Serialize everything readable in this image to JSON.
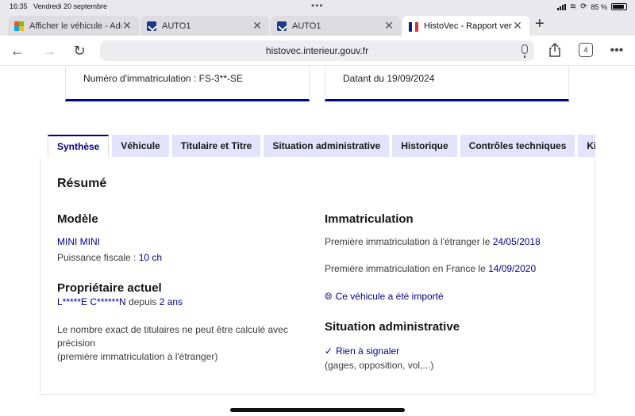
{
  "status_bar": {
    "time": "16:35",
    "date": "Vendredi 20 septembre",
    "battery": "85 %"
  },
  "browser_tabs": [
    {
      "title": "Afficher le véhicule - Adm",
      "favicon": "microsoft-icon",
      "active": false
    },
    {
      "title": "AUTO1",
      "favicon": "auto1-icon",
      "active": false
    },
    {
      "title": "AUTO1",
      "favicon": "auto1-icon",
      "active": false
    },
    {
      "title": "HistoVec - Rapport vendeur",
      "favicon": "france-flag-icon",
      "active": true
    }
  ],
  "toolbar": {
    "url": "histovec.interieur.gouv.fr",
    "tab_count": "4"
  },
  "cards": {
    "registration": "Numéro d'immatriculation : FS-3**-SE",
    "dated": "Datant du 19/09/2024"
  },
  "page_tabs": [
    "Synthèse",
    "Véhicule",
    "Titulaire et Titre",
    "Situation administrative",
    "Historique",
    "Contrôles techniques",
    "Kilométrage"
  ],
  "summary": {
    "title": "Résumé",
    "model": {
      "heading": "Modèle",
      "name": "MINI MINI",
      "power_label": "Puissance fiscale : ",
      "power_value": "10 ch"
    },
    "owner": {
      "heading": "Propriétaire actuel",
      "name": "L*****E C******N",
      "since_label": " depuis ",
      "since_value": "2 ans",
      "note_1": "Le nombre exact de titulaires ne peut être calculé avec précision",
      "note_2": "(première immatriculation à l'étranger)"
    },
    "registration": {
      "heading": "Immatriculation",
      "foreign_label": "Première immatriculation à l'étranger le ",
      "foreign_date": "24/05/2018",
      "france_label": "Première immatriculation en France le ",
      "france_date": "14/09/2020",
      "imported_link": "Ce véhicule a été importé"
    },
    "admin": {
      "heading": "Situation administrative",
      "status": "Rien à signaler",
      "detail": "(gages, opposition, vol,...)"
    }
  },
  "colors": {
    "accent": "#000091",
    "tab_inactive_bg": "#e3e3fd"
  }
}
